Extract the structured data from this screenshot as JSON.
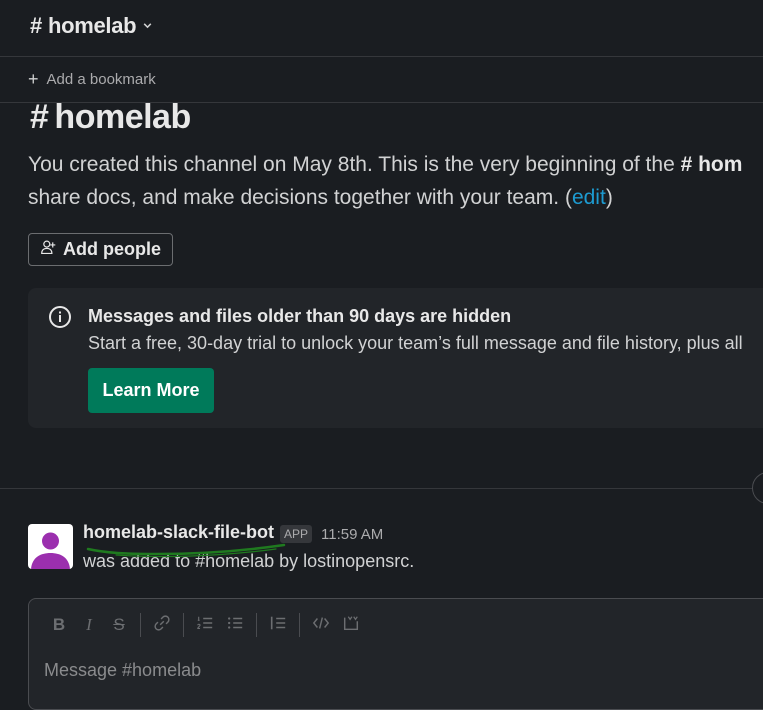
{
  "header": {
    "hash": "#",
    "channel": "homelab",
    "chevron": "⌄"
  },
  "bookmarks": {
    "add_label": "Add a bookmark",
    "plus": "+"
  },
  "intro": {
    "hash": "#",
    "title": "homelab",
    "line1_prefix": "You created this channel on May 8th. This is the very beginning of the ",
    "line1_channel": "# hom",
    "line2_prefix": "share docs, and make decisions together with your team. (",
    "edit_link": "edit",
    "line2_suffix": ")"
  },
  "add_people": {
    "label": "Add people"
  },
  "notice": {
    "title": "Messages and files older than 90 days are hidden",
    "body": "Start a free, 30-day trial to unlock your team’s full message and file history, plus all",
    "button": "Learn More"
  },
  "message": {
    "author": "homelab-slack-file-bot",
    "badge": "APP",
    "time": "11:59 AM",
    "text": "was added to #homelab by lostinopensrc."
  },
  "composer": {
    "placeholder": "Message #homelab",
    "bold": "B",
    "italic": "I",
    "strike": "S"
  },
  "colors": {
    "background": "#1a1d21",
    "accent_green": "#007a5a",
    "link_blue": "#1d9bd1",
    "avatar_purple": "#9b2fae",
    "annotation_green": "#1f7a1f"
  }
}
